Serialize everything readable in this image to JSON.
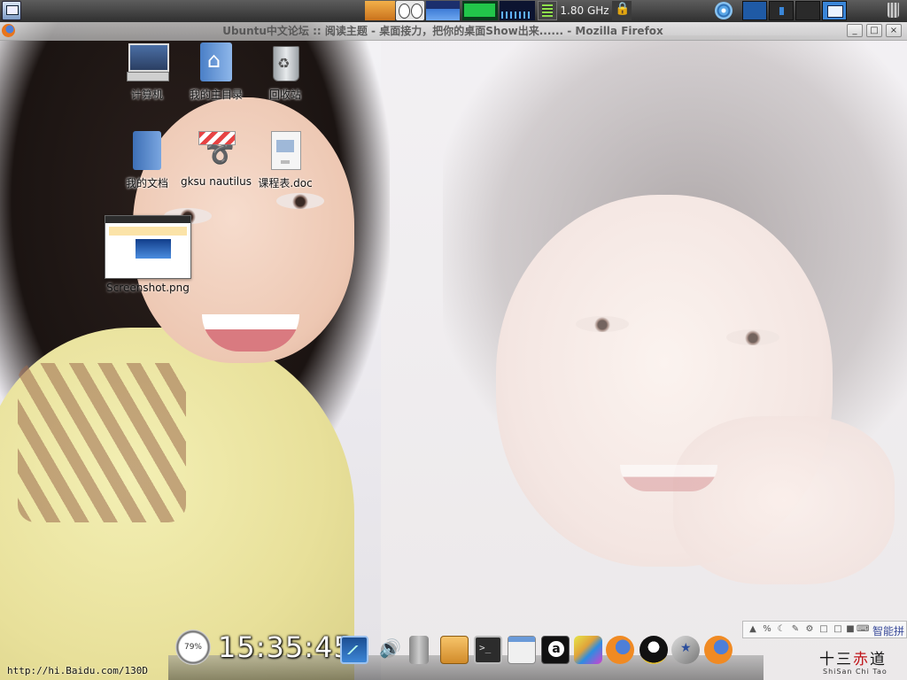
{
  "top_panel": {
    "cpu_freq": "1.80 GHz"
  },
  "window": {
    "title": "Ubuntu中文论坛 :: 阅读主题 - 桌面接力，把你的桌面Show出来...... - Mozilla Firefox",
    "buttons": {
      "minimize": "_",
      "maximize": "□",
      "close": "×"
    }
  },
  "desktop_icons": [
    {
      "label": "计算机",
      "icon": "computer-icon"
    },
    {
      "label": "我的主目录",
      "icon": "home-folder-icon"
    },
    {
      "label": "回收站",
      "icon": "trash-icon"
    },
    {
      "label": "我的文档",
      "icon": "documents-folder-icon"
    },
    {
      "label": "gksu nautilus",
      "icon": "gksu-icon"
    },
    {
      "label": "课程表.doc",
      "icon": "document-icon"
    },
    {
      "label": "Screenshot.png",
      "icon": "image-thumbnail-icon"
    }
  ],
  "input_method": {
    "mode_label": "智能拼"
  },
  "dock": {
    "clock_time": "15:35:45",
    "dial_percent": "79%"
  },
  "status_url": "http://hi.Baidu.com/130D",
  "logo": {
    "main_black": "十三",
    "main_red": "赤",
    "main_black2": "道",
    "sub": "ShiSan Chi Tao"
  }
}
